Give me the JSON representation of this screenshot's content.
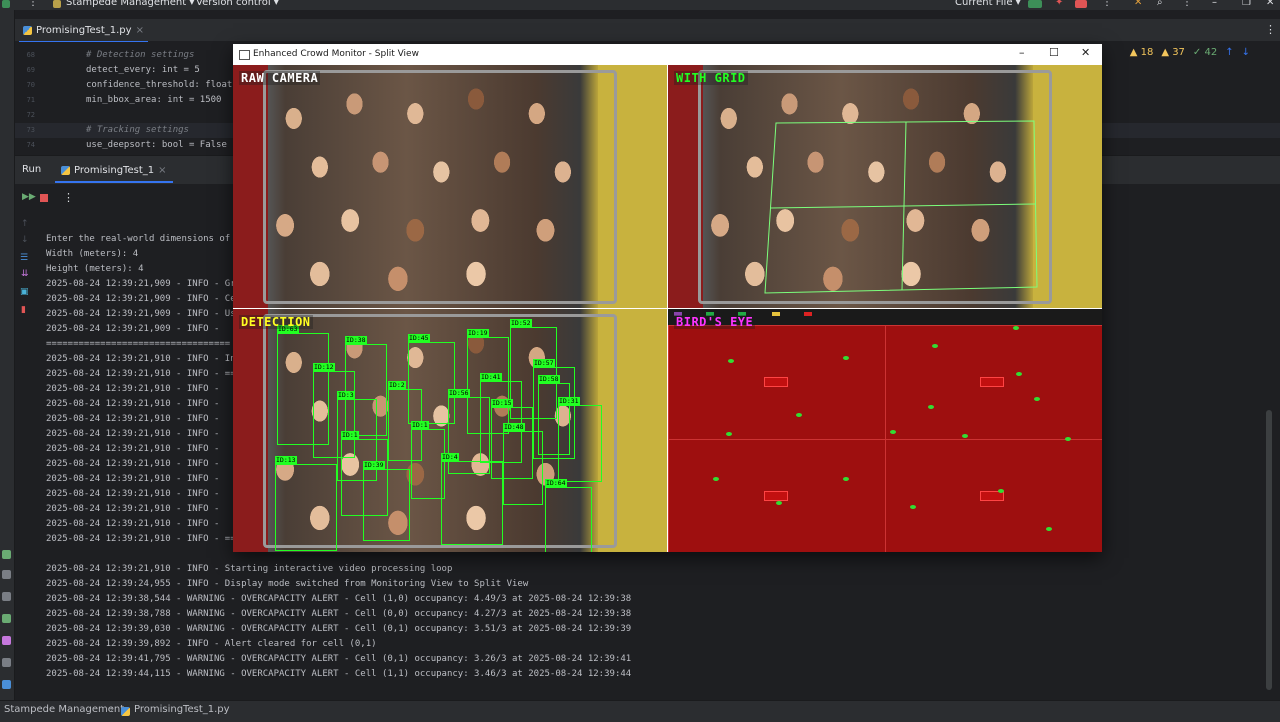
{
  "titlebar": {
    "project": "Stampede Management",
    "vcs": "Version control",
    "run_config": "Current File"
  },
  "editor": {
    "tab_label": "PromisingTest_1.py",
    "lines": [
      {
        "num": "68",
        "text": "# Detection settings",
        "kind": "comment"
      },
      {
        "num": "69",
        "text": "detect_every: int = 5",
        "kind": "code"
      },
      {
        "num": "70",
        "text": "confidence_threshold: float",
        "kind": "code"
      },
      {
        "num": "71",
        "text": "min_bbox_area: int = 1500",
        "kind": "code"
      },
      {
        "num": "72",
        "text": "",
        "kind": "code"
      },
      {
        "num": "73",
        "text": "# Tracking settings",
        "kind": "comment"
      },
      {
        "num": "74",
        "text": "use_deepsort: bool = False",
        "kind": "code"
      }
    ],
    "inspections": {
      "warnings": "18",
      "weak_warnings": "37",
      "ok": "42"
    }
  },
  "run": {
    "title": "Run",
    "tab_label": "PromisingTest_1",
    "console_lines": [
      "Enter the real-world dimensions of",
      "Width (meters): 4",
      "Height (meters): 4",
      "2025-08-24 12:39:21,909 - INFO - Gr",
      "2025-08-24 12:39:21,909 - INFO - Ce",
      "2025-08-24 12:39:21,909 - INFO - Us",
      "2025-08-24 12:39:21,909 - INFO -",
      "==================================",
      "2025-08-24 12:39:21,910 - INFO - In",
      "2025-08-24 12:39:21,910 - INFO - ==",
      "2025-08-24 12:39:21,910 - INFO -",
      "2025-08-24 12:39:21,910 - INFO -",
      "2025-08-24 12:39:21,910 - INFO -",
      "2025-08-24 12:39:21,910 - INFO -",
      "2025-08-24 12:39:21,910 - INFO -",
      "2025-08-24 12:39:21,910 - INFO -",
      "2025-08-24 12:39:21,910 - INFO -",
      "2025-08-24 12:39:21,910 - INFO -",
      "2025-08-24 12:39:21,910 - INFO -",
      "2025-08-24 12:39:21,910 - INFO -",
      "2025-08-24 12:39:21,910 - INFO - ==",
      "",
      "2025-08-24 12:39:21,910 - INFO - Starting interactive video processing loop",
      "2025-08-24 12:39:24,955 - INFO - Display mode switched from Monitoring View to Split View",
      "2025-08-24 12:39:38,544 - WARNING - OVERCAPACITY ALERT - Cell (1,0) occupancy: 4.49/3 at 2025-08-24 12:39:38",
      "2025-08-24 12:39:38,788 - WARNING - OVERCAPACITY ALERT - Cell (0,0) occupancy: 4.27/3 at 2025-08-24 12:39:38",
      "2025-08-24 12:39:39,030 - WARNING - OVERCAPACITY ALERT - Cell (0,1) occupancy: 3.51/3 at 2025-08-24 12:39:39",
      "2025-08-24 12:39:39,892 - INFO - Alert cleared for cell (0,1)",
      "2025-08-24 12:39:41,795 - WARNING - OVERCAPACITY ALERT - Cell (0,1) occupancy: 3.26/3 at 2025-08-24 12:39:41",
      "2025-08-24 12:39:44,115 - WARNING - OVERCAPACITY ALERT - Cell (1,1) occupancy: 3.46/3 at 2025-08-24 12:39:44"
    ]
  },
  "statusbar": {
    "project": "Stampede Management",
    "file": "PromisingTest_1.py"
  },
  "cv_window": {
    "title": "Enhanced Crowd Monitor - Split View",
    "panes": {
      "raw": "RAW CAMERA",
      "grid": "WITH GRID",
      "detection": "DETECTION",
      "birdseye": "BIRD'S EYE"
    },
    "detections": [
      {
        "id": "ID:63"
      },
      {
        "id": "ID:38"
      },
      {
        "id": "ID:45"
      },
      {
        "id": "ID:19"
      },
      {
        "id": "ID:52"
      },
      {
        "id": "ID:12"
      },
      {
        "id": "ID:57"
      },
      {
        "id": "ID:41"
      },
      {
        "id": "ID:58"
      },
      {
        "id": "ID:3"
      },
      {
        "id": "ID:2"
      },
      {
        "id": "ID:56"
      },
      {
        "id": "ID:15"
      },
      {
        "id": "ID:31"
      },
      {
        "id": "ID:1"
      },
      {
        "id": "ID:1"
      },
      {
        "id": "ID:48"
      },
      {
        "id": "ID:4"
      },
      {
        "id": "ID:13"
      },
      {
        "id": "ID:39"
      },
      {
        "id": "ID:64"
      }
    ]
  },
  "colors": {
    "accent": "#3574f0",
    "detection_green": "#22ff22",
    "grid_label": "#22ff22",
    "birdseye_label": "#ff33ff",
    "raw_label": "#ffffff",
    "detection_label": "#ffff22"
  }
}
